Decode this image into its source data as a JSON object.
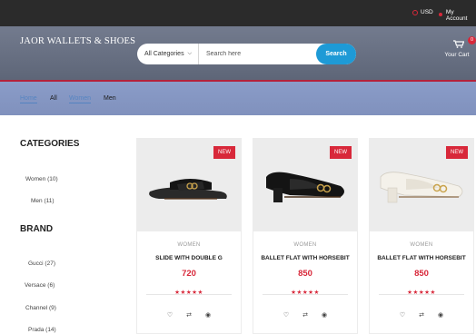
{
  "topbar": {
    "currency": "USD",
    "account": "My Account"
  },
  "header": {
    "logo": "JAOR WALLETS & SHOES",
    "search": {
      "category_selected": "All Categories",
      "placeholder": "Search here",
      "button_label": "Search"
    },
    "cart": {
      "count": "0",
      "label": "Your Cart"
    }
  },
  "nav": {
    "items": [
      {
        "label": "Home",
        "active": true
      },
      {
        "label": "All",
        "active": false
      },
      {
        "label": "Women",
        "active": true
      },
      {
        "label": "Men",
        "active": false
      }
    ]
  },
  "sidebar": {
    "categories_title": "CATEGORIES",
    "categories": [
      "Women (10)",
      "Men (11)"
    ],
    "brand_title": "BRAND",
    "brands": [
      "Gucci (27)",
      "Versace (6)",
      "Channel (9)",
      "Prada (14)"
    ]
  },
  "products": [
    {
      "badge": "NEW",
      "category": "WOMEN",
      "title": "SLIDE WITH DOUBLE G",
      "price": "720",
      "rating": "★★★★★"
    },
    {
      "badge": "NEW",
      "category": "WOMEN",
      "title": "BALLET FLAT WITH HORSEBIT",
      "price": "850",
      "rating": "★★★★★"
    },
    {
      "badge": "NEW",
      "category": "WOMEN",
      "title": "BALLET FLAT WITH HORSEBIT",
      "price": "850",
      "rating": "★★★★★"
    }
  ],
  "icons": {
    "wishlist": "heart-icon",
    "compare": "exchange-icon",
    "quick_view": "eye-icon"
  },
  "colors": {
    "accent_red": "#d8283a",
    "search_blue": "#1e9ad6",
    "topbar": "#2b2b2b"
  }
}
